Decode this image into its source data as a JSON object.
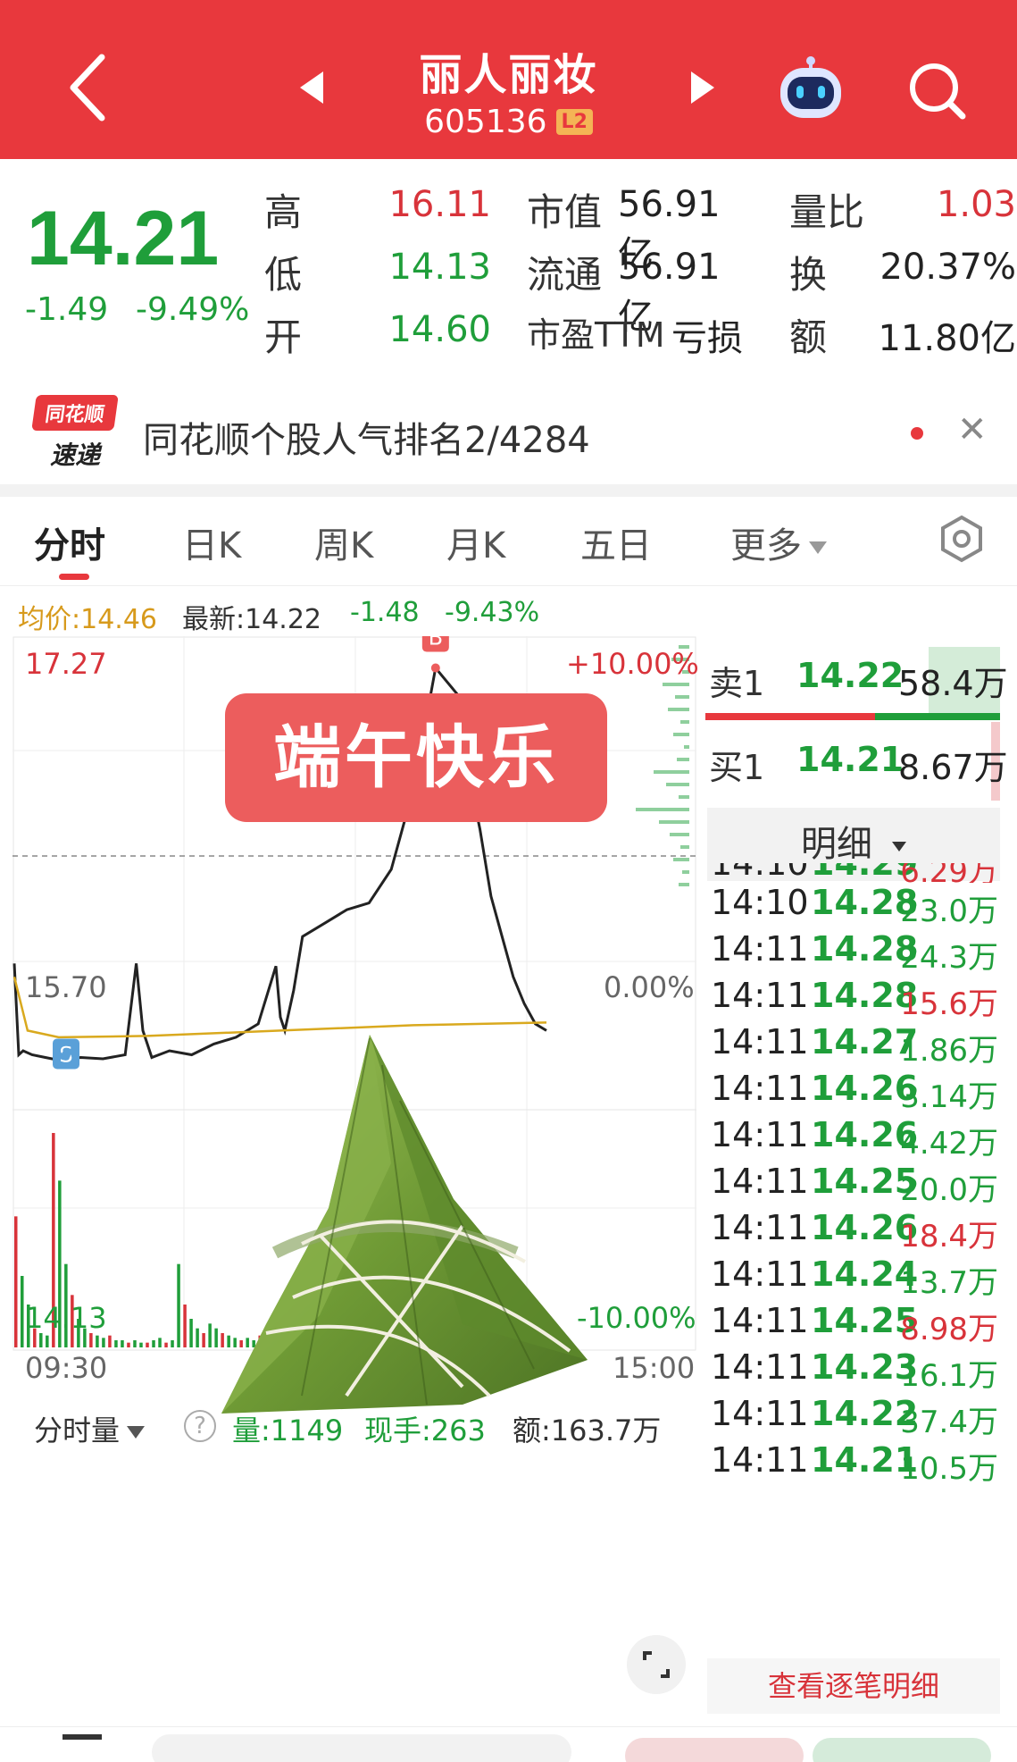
{
  "header": {
    "title": "丽人丽妆",
    "code": "605136",
    "level_badge": "L2"
  },
  "quote": {
    "price": "14.21",
    "change": "-1.49",
    "change_pct": "-9.49%",
    "high_label": "高",
    "high": "16.11",
    "low_label": "低",
    "low": "14.13",
    "open_label": "开",
    "open": "14.60",
    "mktcap_label": "市值",
    "mktcap": "56.91亿",
    "float_label": "流通",
    "float": "56.91亿",
    "pe_label": "市盈TTM",
    "pe": "亏损",
    "volratio_label": "量比",
    "volratio": "1.03",
    "turnover_label": "换",
    "turnover": "20.37%",
    "amount_label": "额",
    "amount": "11.80亿"
  },
  "popularity": {
    "logo_top": "同花顺",
    "logo_bottom": "速递",
    "text": "同花顺个股人气排名2/4284"
  },
  "tabs": {
    "items": [
      "分时",
      "日K",
      "周K",
      "月K",
      "五日",
      "更多"
    ]
  },
  "info": {
    "avg": "均价:14.46",
    "latest": "最新:14.22",
    "chg": "-1.48",
    "chg_pct": "-9.43%"
  },
  "chart_data": {
    "type": "line",
    "title": "",
    "overlay_text": "端午快乐",
    "y_axis_left": [
      "17.27",
      "15.70",
      "14.13"
    ],
    "y_axis_right": [
      "+10.00%",
      "0.00%",
      "-10.00%"
    ],
    "x_axis": [
      "09:30",
      "15:00"
    ],
    "ylim": [
      14.13,
      17.27
    ],
    "markers": [
      "B",
      "S"
    ],
    "series": [
      {
        "x": [
          0,
          2,
          4,
          8,
          14,
          20,
          30,
          40,
          50,
          55,
          58,
          60,
          62,
          70,
          80,
          90,
          100,
          110,
          118,
          120,
          122,
          126,
          130,
          140,
          150,
          160,
          170,
          180,
          190,
          200,
          205,
          210,
          215,
          220,
          225,
          230,
          235,
          240
        ],
        "y": [
          14.9,
          14.22,
          14.25,
          14.22,
          14.2,
          14.18,
          14.2,
          14.19,
          14.22,
          14.9,
          14.4,
          14.3,
          14.2,
          14.25,
          14.22,
          14.3,
          14.35,
          14.45,
          14.88,
          14.5,
          14.4,
          14.7,
          15.1,
          15.2,
          15.3,
          15.35,
          15.6,
          16.2,
          17.1,
          16.9,
          16.3,
          15.9,
          15.4,
          15.1,
          14.8,
          14.6,
          14.45,
          14.4
        ]
      }
    ],
    "avg_series": {
      "x": [
        0,
        6,
        20,
        60,
        120,
        180,
        240
      ],
      "y": [
        14.8,
        14.4,
        14.35,
        14.36,
        14.4,
        14.44,
        14.46
      ]
    }
  },
  "volume": {
    "selector": "分时量",
    "vol": "量:1149",
    "hand": "现手:263",
    "amt": "额:163.7万",
    "values": [
      55,
      30,
      18,
      8,
      6,
      5,
      90,
      70,
      35,
      22,
      12,
      8,
      6,
      5,
      4,
      5,
      3,
      3,
      2,
      3,
      2,
      2,
      3,
      4,
      2,
      3,
      35,
      18,
      12,
      8,
      6,
      10,
      8,
      6,
      5,
      4,
      3,
      4,
      3,
      5,
      4,
      3,
      6,
      5,
      4,
      4,
      3,
      5,
      6,
      4,
      3,
      4,
      5,
      6,
      8,
      5,
      4,
      3,
      5,
      4,
      3,
      4,
      6,
      5,
      4,
      7,
      8,
      10,
      12,
      9,
      7,
      6,
      5,
      4,
      5,
      4,
      3,
      4,
      3,
      2,
      3,
      2,
      3,
      2,
      2
    ]
  },
  "orderbook": {
    "sell_label": "卖1",
    "sell_price": "14.22",
    "sell_vol": "58.4万",
    "buy_label": "买1",
    "buy_price": "14.21",
    "buy_vol": "8.67万",
    "detail_label": "明细"
  },
  "ticks": [
    {
      "t": "14:10",
      "p": "14.29",
      "v": "6.29万",
      "c": "red"
    },
    {
      "t": "14:10",
      "p": "14.28",
      "v": "23.0万",
      "c": "green"
    },
    {
      "t": "14:11",
      "p": "14.28",
      "v": "24.3万",
      "c": "green"
    },
    {
      "t": "14:11",
      "p": "14.28",
      "v": "15.6万",
      "c": "red"
    },
    {
      "t": "14:11",
      "p": "14.27",
      "v": "1.86万",
      "c": "green"
    },
    {
      "t": "14:11",
      "p": "14.26",
      "v": "3.14万",
      "c": "green"
    },
    {
      "t": "14:11",
      "p": "14.26",
      "v": "4.42万",
      "c": "green"
    },
    {
      "t": "14:11",
      "p": "14.25",
      "v": "20.0万",
      "c": "green"
    },
    {
      "t": "14:11",
      "p": "14.26",
      "v": "18.4万",
      "c": "red"
    },
    {
      "t": "14:11",
      "p": "14.24",
      "v": "13.7万",
      "c": "green"
    },
    {
      "t": "14:11",
      "p": "14.25",
      "v": "8.98万",
      "c": "red"
    },
    {
      "t": "14:11",
      "p": "14.23",
      "v": "16.1万",
      "c": "green"
    },
    {
      "t": "14:11",
      "p": "14.22",
      "v": "37.4万",
      "c": "green"
    },
    {
      "t": "14:11",
      "p": "14.21",
      "v": "10.5万",
      "c": "green"
    }
  ],
  "view_all": "查看逐笔明细",
  "colors": {
    "brand_red": "#e8383d",
    "up": "#d8333a",
    "down": "#1f9e3a"
  }
}
